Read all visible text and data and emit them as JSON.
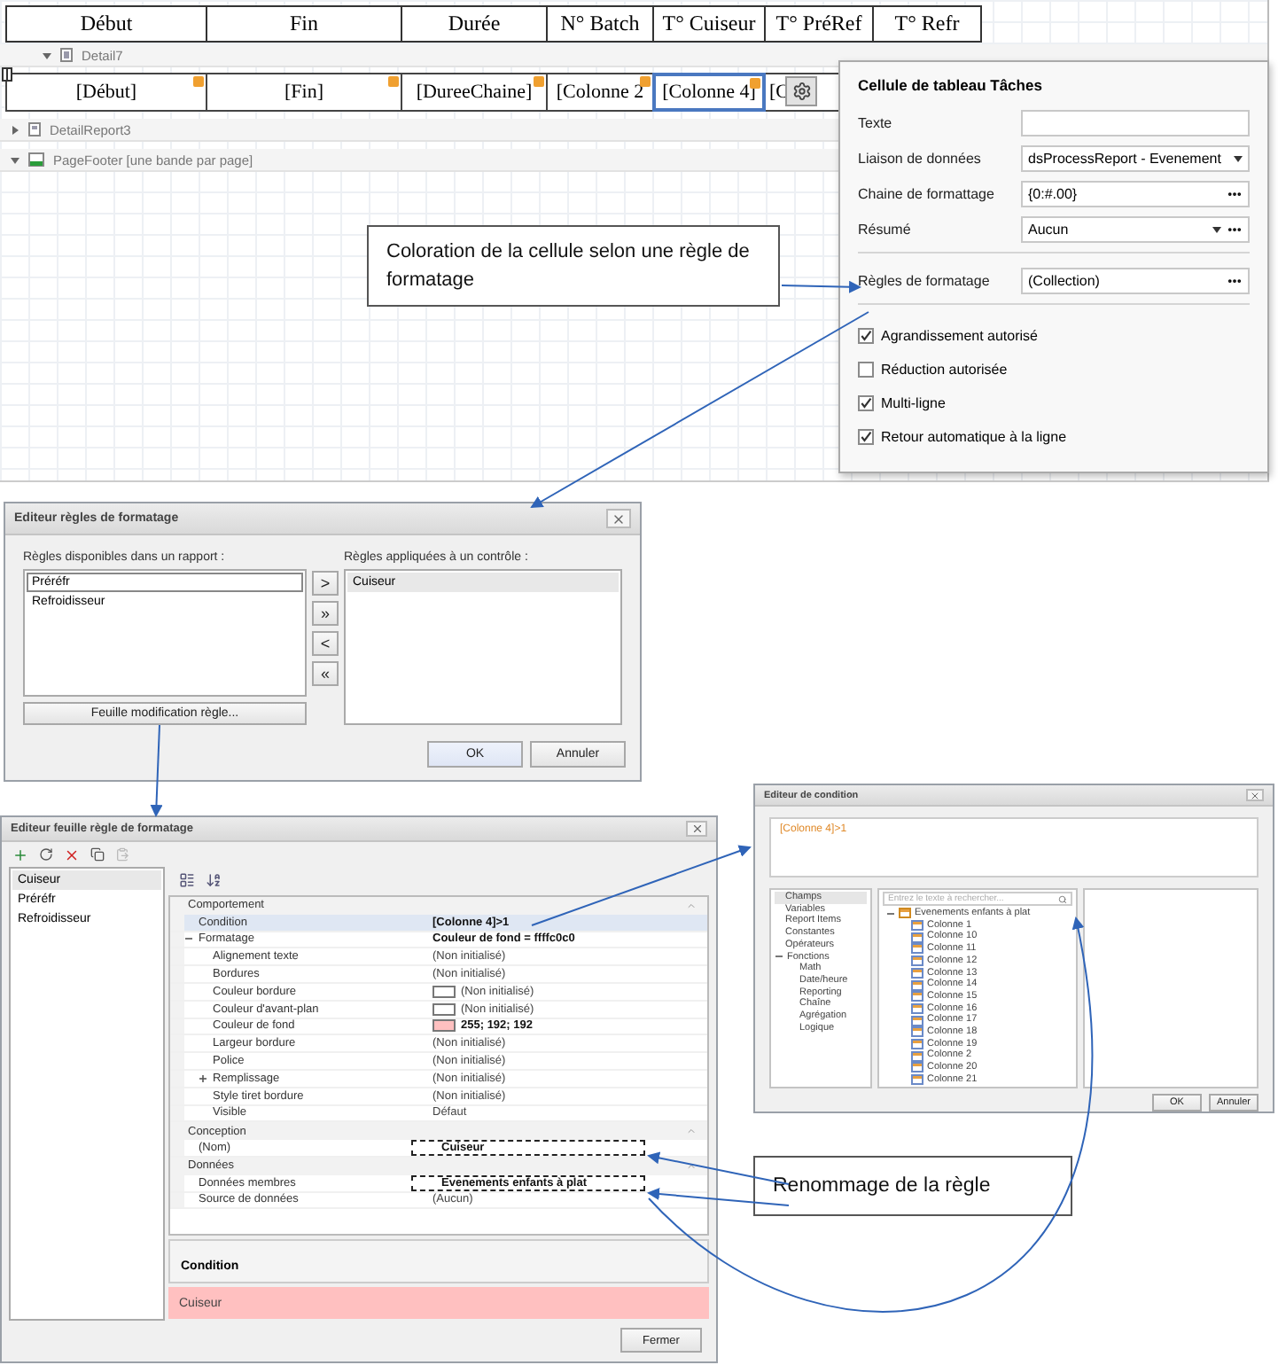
{
  "designer": {
    "header_columns": [
      "Début",
      "Fin",
      "Durée",
      "N° Batch",
      "T° Cuiseur",
      "T° PréRef",
      "T° Refr"
    ],
    "bands": [
      {
        "kind": "detail",
        "label": "Detail7",
        "expanded": true,
        "cells": [
          {
            "text": "[Début]",
            "selected": false
          },
          {
            "text": "[Fin]",
            "selected": false
          },
          {
            "text": "[DureeChaine]",
            "selected": false
          },
          {
            "text": "[Colonne 2",
            "selected": false
          },
          {
            "text": "[Colonne 4]",
            "selected": true
          },
          {
            "text": "[C",
            "selected": false
          }
        ]
      },
      {
        "kind": "detail_report",
        "label": "DetailReport3",
        "expanded": false
      },
      {
        "kind": "page_footer",
        "label": "PageFooter [une bande par page]",
        "expanded": true
      }
    ],
    "callout": "Coloration de la cellule selon une règle de formatage"
  },
  "smart_tag_panel": {
    "title": "Cellule de tableau Tâches",
    "field_groups": [
      [
        {
          "label": "Texte",
          "kind": "text"
        },
        {
          "label": "Liaison de données",
          "kind": "dropdown",
          "value": "dsProcessReport - Evenement"
        },
        {
          "label": "Chaine de formattage",
          "kind": "ellipsis",
          "value": "{0:#.00}"
        },
        {
          "label": "Résumé",
          "kind": "dropdown_ellipsis",
          "value": "Aucun"
        }
      ],
      [
        {
          "label": "Règles de formatage",
          "kind": "ellipsis",
          "value": "(Collection)"
        }
      ]
    ],
    "options": [
      {
        "label": "Agrandissement autorisé",
        "checked": true
      },
      {
        "label": "Réduction autorisée",
        "checked": false
      },
      {
        "label": "Multi-ligne",
        "checked": true
      },
      {
        "label": "Retour automatique à la ligne",
        "checked": true
      }
    ]
  },
  "rules_dialog": {
    "title": "Editeur règles de formatage",
    "available_label": "Règles disponibles dans un rapport :",
    "available_rules": [
      {
        "name": "Préréfr",
        "selected": true
      },
      {
        "name": "Refroidisseur",
        "selected": false
      }
    ],
    "move_buttons": [
      ">",
      "»",
      "<",
      "«"
    ],
    "applied_label": "Règles appliquées à un contrôle :",
    "applied_rules": [
      {
        "name": "Cuiseur",
        "selected": true
      }
    ],
    "sheet_button": "Feuille modification règle...",
    "buttons": [
      "OK",
      "Annuler"
    ]
  },
  "sheet_dialog": {
    "title": "Editeur feuille règle de formatage",
    "rules": [
      {
        "name": "Cuiseur",
        "selected": true
      },
      {
        "name": "Préréfr",
        "selected": false
      },
      {
        "name": "Refroidisseur",
        "selected": false
      }
    ],
    "categories": [
      {
        "name": "Comportement",
        "properties": [
          {
            "name": "Condition",
            "value": "[Colonne 4]>1",
            "selected": true,
            "bold": true,
            "highlighted": false
          },
          {
            "name": "Formatage",
            "value": "Couleur de fond = ffffc0c0",
            "selected": false,
            "bold": true,
            "highlighted": false,
            "expanded": true,
            "children": [
              {
                "name": "Alignement texte",
                "value": "(Non initialisé)",
                "selected": false,
                "bold": false,
                "highlighted": false
              },
              {
                "name": "Bordures",
                "value": "(Non initialisé)",
                "selected": false,
                "bold": false,
                "highlighted": false
              },
              {
                "name": "Couleur bordure",
                "value": "(Non initialisé)",
                "selected": false,
                "bold": false,
                "highlighted": false,
                "color": "#ffffff"
              },
              {
                "name": "Couleur d'avant-plan",
                "value": "(Non initialisé)",
                "selected": false,
                "bold": false,
                "highlighted": false,
                "color": "#ffffff"
              },
              {
                "name": "Couleur de fond",
                "value": "255; 192; 192",
                "selected": false,
                "bold": true,
                "highlighted": false,
                "color": "#ffc0c0"
              },
              {
                "name": "Largeur bordure",
                "value": "(Non initialisé)",
                "selected": false,
                "bold": false,
                "highlighted": false
              },
              {
                "name": "Police",
                "value": "(Non initialisé)",
                "selected": false,
                "bold": false,
                "highlighted": false
              },
              {
                "name": "Remplissage",
                "value": "(Non initialisé)",
                "selected": false,
                "bold": false,
                "highlighted": false,
                "expanded": false
              },
              {
                "name": "Style tiret bordure",
                "value": "(Non initialisé)",
                "selected": false,
                "bold": false,
                "highlighted": false
              },
              {
                "name": "Visible",
                "value": "Défaut",
                "selected": false,
                "bold": false,
                "highlighted": false
              }
            ]
          }
        ]
      },
      {
        "name": "Conception",
        "properties": [
          {
            "name": "(Nom)",
            "value": "Cuiseur",
            "selected": false,
            "bold": true,
            "highlighted": true
          }
        ]
      },
      {
        "name": "Données",
        "properties": [
          {
            "name": "Données membres",
            "value": "Evenements enfants à plat",
            "selected": false,
            "bold": true,
            "highlighted": true
          },
          {
            "name": "Source de données",
            "value": "(Aucun)",
            "selected": false,
            "bold": false,
            "highlighted": false
          }
        ]
      }
    ],
    "description_title": "Condition",
    "preview": "Cuiseur",
    "close_button": "Fermer"
  },
  "condition_editor": {
    "title": "Editeur de condition",
    "expression": "[Colonne 4]>1",
    "categories": [
      {
        "name": "Champs",
        "selected": true
      },
      {
        "name": "Variables",
        "selected": false
      },
      {
        "name": "Report Items",
        "selected": false
      },
      {
        "name": "Constantes",
        "selected": false
      },
      {
        "name": "Opérateurs",
        "selected": false
      },
      {
        "name": "Fonctions",
        "selected": false,
        "expanded": true,
        "children": [
          {
            "name": "Math",
            "selected": false
          },
          {
            "name": "Date/heure",
            "selected": false
          },
          {
            "name": "Reporting",
            "selected": false
          },
          {
            "name": "Chaîne",
            "selected": false
          },
          {
            "name": "Agrégation",
            "selected": false
          },
          {
            "name": "Logique",
            "selected": false
          }
        ]
      }
    ],
    "search_placeholder": "Entrez le texte à rechercher...",
    "field_tree": {
      "name": "Evenements enfants à plat",
      "expanded": true,
      "children": [
        {
          "name": "Colonne 1"
        },
        {
          "name": "Colonne 10"
        },
        {
          "name": "Colonne 11"
        },
        {
          "name": "Colonne 12"
        },
        {
          "name": "Colonne 13"
        },
        {
          "name": "Colonne 14"
        },
        {
          "name": "Colonne 15"
        },
        {
          "name": "Colonne 16"
        },
        {
          "name": "Colonne 17"
        },
        {
          "name": "Colonne 18"
        },
        {
          "name": "Colonne 19"
        },
        {
          "name": "Colonne 2"
        },
        {
          "name": "Colonne 20"
        },
        {
          "name": "Colonne 21"
        }
      ]
    },
    "buttons": [
      "OK",
      "Annuler"
    ]
  },
  "rename_callout": "Renommage de la règle"
}
